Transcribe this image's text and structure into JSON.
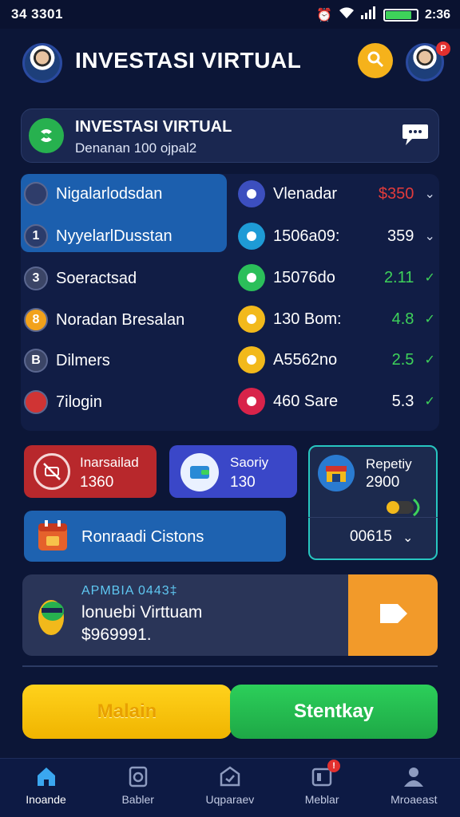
{
  "status_bar": {
    "time": "34 3301",
    "clock": "2:36",
    "battery_level": 0.85
  },
  "header": {
    "title": "INVESTASI VIRTUAL",
    "profile_badge": "P"
  },
  "info_card": {
    "title": "INVESTASI VIRTUAL",
    "subtitle": "Denanan 100 ojpal2"
  },
  "left_list": [
    {
      "label": "Nigalarlodsdan",
      "badge": "",
      "icon_color": "#2f3d6a"
    },
    {
      "label": "NyyelarlDusstan",
      "badge": "1",
      "icon_color": "#2b3c6b"
    },
    {
      "label": "Soeractsad",
      "badge": "3",
      "icon_color": "#3b4566"
    },
    {
      "label": "Noradan Bresalan",
      "badge": "8",
      "icon_color": "#f2a21b"
    },
    {
      "label": "Dilmers",
      "badge": "B",
      "icon_color": "#3b4566"
    },
    {
      "label": "7ilogin",
      "badge": "",
      "icon_color": "#d03434"
    }
  ],
  "right_list": [
    {
      "label": "Vlenadar",
      "value": "$350",
      "value_color": "#e23b3b",
      "icon_color": "#3c4fbf",
      "icon": "fox-icon",
      "chevron": "⌄"
    },
    {
      "label": "1506a09:",
      "value": "359",
      "value_color": "#ffffff",
      "icon_color": "#1e9bd6",
      "icon": "shield-icon",
      "chevron": "⌄"
    },
    {
      "label": "15076do",
      "value": "2.11",
      "value_color": "#3ed25a",
      "icon_color": "#2bbf5a",
      "icon": "chart-icon",
      "chevron": "✓"
    },
    {
      "label": "130 Bom:",
      "value": "4.8",
      "value_color": "#3ed25a",
      "icon_color": "#f2b91b",
      "icon": "coin-icon",
      "chevron": "✓"
    },
    {
      "label": "A5562no",
      "value": "2.5",
      "value_color": "#3ed25a",
      "icon_color": "#f2b91b",
      "icon": "coin-icon",
      "chevron": "✓"
    },
    {
      "label": "460 Sare",
      "value": "5.3",
      "value_color": "#ffffff",
      "icon_color": "#d8234a",
      "icon": "heart-icon",
      "chevron": "✓"
    }
  ],
  "tiles": {
    "red": {
      "label": "Inarsailad",
      "value": "1360"
    },
    "blue": {
      "label": "Saoriy",
      "value": "130"
    },
    "right": {
      "label": "Repetiy",
      "value": "2900",
      "footer": "00615"
    },
    "wide": {
      "label": "Ronraadi Cistons"
    }
  },
  "banner": {
    "kicker": "APMBIA 0443‡",
    "title": "lonuebi Virttuam",
    "amount": "$969991."
  },
  "buttons": {
    "left": "Malain",
    "right": "Stentkay"
  },
  "bottom_nav": [
    {
      "label": "Inoande",
      "icon": "home-icon",
      "active": true
    },
    {
      "label": "Babler",
      "icon": "clock-icon",
      "active": false
    },
    {
      "label": "Uqparaev",
      "icon": "box-icon",
      "active": false
    },
    {
      "label": "Meblar",
      "icon": "grid-icon",
      "active": false,
      "badge": "!"
    },
    {
      "label": "Mroaeast",
      "icon": "user-icon",
      "active": false
    }
  ]
}
